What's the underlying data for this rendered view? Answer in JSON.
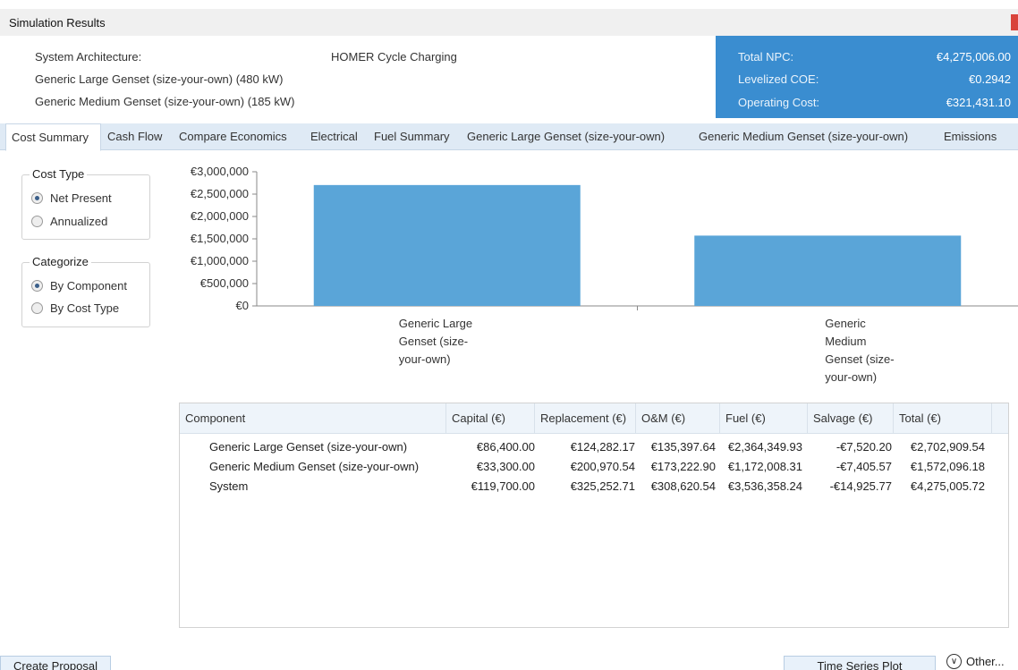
{
  "window": {
    "title": "Simulation Results"
  },
  "architecture": {
    "label": "System Architecture:",
    "components": [
      "Generic Large Genset (size-your-own) (480 kW)",
      "Generic Medium Genset (size-your-own) (185 kW)"
    ],
    "strategy": "HOMER Cycle Charging"
  },
  "costs": {
    "npc_label": "Total NPC:",
    "npc_value": "€4,275,006.00",
    "coe_label": "Levelized COE:",
    "coe_value": "€0.2942",
    "op_label": "Operating Cost:",
    "op_value": "€321,431.10"
  },
  "tabs": [
    "Cost Summary",
    "Cash Flow",
    "Compare Economics",
    "Electrical",
    "Fuel Summary",
    "Generic Large Genset (size-your-own)",
    "Generic Medium Genset (size-your-own)",
    "Emissions"
  ],
  "cost_type": {
    "title": "Cost Type",
    "options": [
      "Net Present",
      "Annualized"
    ],
    "selected": "Net Present"
  },
  "categorize": {
    "title": "Categorize",
    "options": [
      "By Component",
      "By Cost Type"
    ],
    "selected": "By Component"
  },
  "chart_data": {
    "type": "bar",
    "categories": [
      [
        "Generic Large",
        "Genset (size-",
        "your-own)"
      ],
      [
        "Generic",
        "Medium",
        "Genset (size-",
        "your-own)"
      ]
    ],
    "values": [
      2702909.54,
      1572096.18
    ],
    "yticks": [
      "€0",
      "€500,000",
      "€1,000,000",
      "€1,500,000",
      "€2,000,000",
      "€2,500,000",
      "€3,000,000"
    ],
    "ylim": [
      0,
      3000000
    ],
    "color": "#5aa5d8"
  },
  "table": {
    "headers": [
      "Component",
      "Capital (€)",
      "Replacement (€)",
      "O&M (€)",
      "Fuel (€)",
      "Salvage (€)",
      "Total (€)"
    ],
    "rows": [
      [
        "Generic Large Genset (size-your-own)",
        "€86,400.00",
        "€124,282.17",
        "€135,397.64",
        "€2,364,349.93",
        "-€7,520.20",
        "€2,702,909.54"
      ],
      [
        "Generic Medium Genset (size-your-own)",
        "€33,300.00",
        "€200,970.54",
        "€173,222.90",
        "€1,172,008.31",
        "-€7,405.57",
        "€1,572,096.18"
      ],
      [
        "System",
        "€119,700.00",
        "€325,252.71",
        "€308,620.54",
        "€3,536,358.24",
        "-€14,925.77",
        "€4,275,005.72"
      ]
    ]
  },
  "buttons": {
    "create_proposal": "Create Proposal",
    "time_series": "Time Series Plot",
    "other": "Other..."
  },
  "icons": {
    "other": "chevron-down-icon"
  },
  "colors": {
    "accent": "#3a8dd0",
    "bar": "#5aa5d8",
    "tab_bar": "#dfeaf5"
  }
}
